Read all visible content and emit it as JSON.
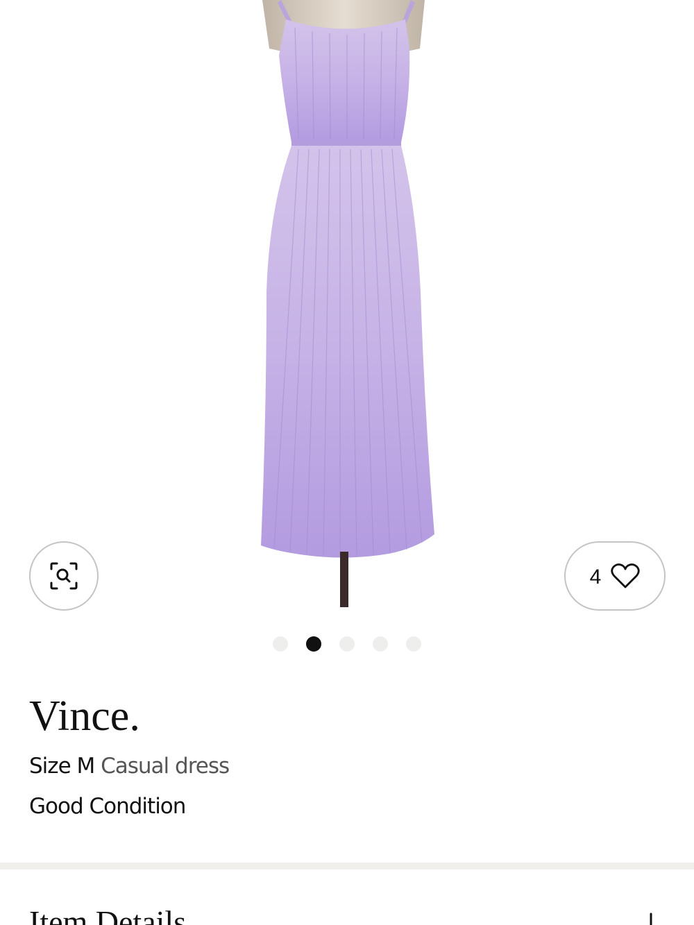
{
  "gallery": {
    "slide_count": 5,
    "active_index": 1
  },
  "favorites": {
    "count": "4"
  },
  "item": {
    "brand": "Vince.",
    "size": "Size M",
    "category": "Casual dress",
    "condition": "Good Condition"
  },
  "details": {
    "title": "Item Details"
  },
  "icons": {
    "zoom": "zoom-search-icon",
    "favorite": "heart-icon",
    "expand": "plus-icon"
  },
  "colors": {
    "dress": "#c4aee4",
    "active_dot": "#111111",
    "inactive_dot": "#eeeeec",
    "divider": "#f0efeb"
  }
}
